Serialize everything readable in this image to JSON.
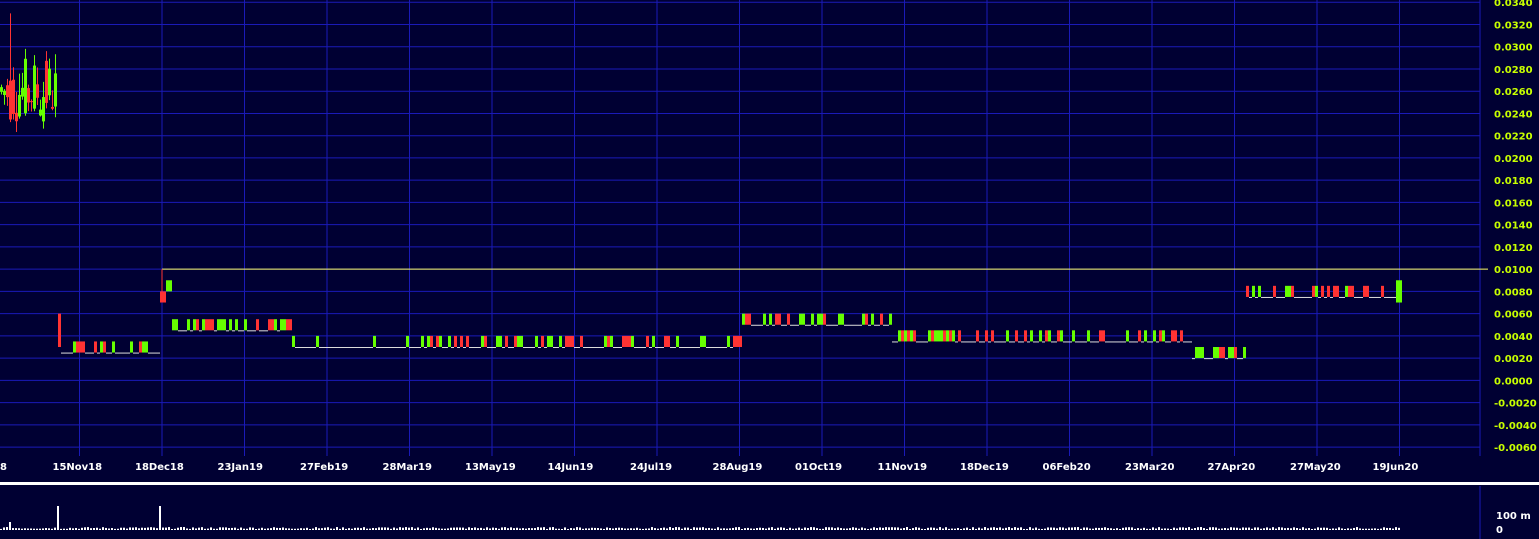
{
  "chart_data": [
    {
      "type": "candlestick",
      "y_ticks": [
        "0.0340",
        "0.0320",
        "0.0300",
        "0.0280",
        "0.0260",
        "0.0240",
        "0.0220",
        "0.0200",
        "0.0180",
        "0.0160",
        "0.0140",
        "0.0120",
        "0.0100",
        "0.0080",
        "0.0060",
        "0.0040",
        "0.0020",
        "0.0000",
        "-0.0020",
        "-0.0040",
        "-0.0060"
      ],
      "ylim": [
        -0.0068,
        0.0342
      ],
      "grid": true,
      "x_ticks": [
        "8",
        "15Nov18",
        "18Dec18",
        "23Jan19",
        "27Feb19",
        "28Mar19",
        "13May19",
        "14Jun19",
        "24Jul19",
        "28Aug19",
        "01Oct19",
        "11Nov19",
        "18Dec19",
        "06Feb20",
        "23Mar20",
        "27Apr20",
        "27May20",
        "19Jun20"
      ],
      "reference_line": 0.01,
      "colors": {
        "background": "#000033",
        "grid": "#1a1ab8",
        "up": "#66ff00",
        "down": "#ff3333",
        "flat": "#dddddd",
        "reference": "#ffff66",
        "y_tick_text": "#c8ff00",
        "x_tick_text": "#ffffff",
        "separator": "#ffffff",
        "volume": "#ffffff"
      },
      "segments": [
        {
          "period": "early Oct-Nov 2018",
          "open_range": [
            0.023,
            0.029
          ],
          "high": 0.033,
          "low": 0.023
        },
        {
          "period": "Nov-Dec 2018",
          "level": 0.0025,
          "first_high": 0.006
        },
        {
          "period": "18Dec18",
          "high": 0.01,
          "level": 0.008
        },
        {
          "period": "Jan-Feb 2019",
          "level": 0.0045
        },
        {
          "period": "Feb-Jul 2019",
          "level": 0.003
        },
        {
          "period": "Aug-Oct 2019",
          "level": 0.005,
          "high": 0.006
        },
        {
          "period": "Nov 2019-Feb 2020",
          "level": 0.0035
        },
        {
          "period": "Mar 2020",
          "level": 0.002,
          "low": 0.002
        },
        {
          "period": "Apr-May 2020",
          "level": 0.0075,
          "high": 0.009,
          "last": 0.009
        }
      ]
    },
    {
      "type": "bar",
      "name": "volume",
      "y_ticks": [
        "100 m",
        "0"
      ]
    }
  ]
}
